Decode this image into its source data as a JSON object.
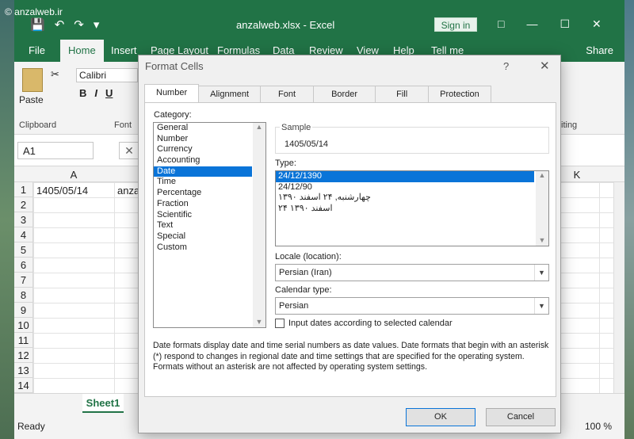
{
  "watermark": "© anzalweb.ir",
  "title": {
    "file": "anzalweb.xlsx - Excel",
    "signin": "Sign in",
    "share": "Share"
  },
  "tabs": [
    {
      "label": "File"
    },
    {
      "label": "Home"
    },
    {
      "label": "Insert"
    },
    {
      "label": "Page Layout"
    },
    {
      "label": "Formulas"
    },
    {
      "label": "Data"
    },
    {
      "label": "Review"
    },
    {
      "label": "View"
    },
    {
      "label": "Help"
    },
    {
      "label": "Tell me"
    }
  ],
  "ribbon": {
    "paste": "Paste",
    "font_name": "Calibri",
    "clipboard": "Clipboard",
    "font": "Font",
    "editing": "iting"
  },
  "namebox": "A1",
  "sheet": {
    "col_a": "A",
    "col_k": "K",
    "rows": [
      "1",
      "2",
      "3",
      "4",
      "5",
      "6",
      "7",
      "8",
      "9",
      "10",
      "11",
      "12",
      "13",
      "14"
    ],
    "a1": "1405/05/14",
    "b1": "anza",
    "tab": "Sheet1"
  },
  "status": {
    "ready": "Ready",
    "zoom": "100 %"
  },
  "dialog": {
    "title": "Format Cells",
    "help": "?",
    "tabs": [
      {
        "label": "Number"
      },
      {
        "label": "Alignment"
      },
      {
        "label": "Font"
      },
      {
        "label": "Border"
      },
      {
        "label": "Fill"
      },
      {
        "label": "Protection"
      }
    ],
    "category_label": "Category:",
    "categories": [
      "General",
      "Number",
      "Currency",
      "Accounting",
      "Date",
      "Time",
      "Percentage",
      "Fraction",
      "Scientific",
      "Text",
      "Special",
      "Custom"
    ],
    "selected_category": "Date",
    "sample_label": "Sample",
    "sample_value": "1405/05/14",
    "type_label": "Type:",
    "types": [
      "24/12/1390",
      "24/12/90",
      "چهارشنبه, ۲۴ اسفند ۱۳۹۰",
      "۲۴ اسفند ۱۳۹۰"
    ],
    "locale_label": "Locale (location):",
    "locale_value": "Persian (Iran)",
    "calendar_label": "Calendar type:",
    "calendar_value": "Persian",
    "checkbox_label": "Input dates according to selected calendar",
    "description": "Date formats display date and time serial numbers as date values.  Date formats that begin with an asterisk (*) respond to changes in regional date and time settings that are specified for the operating system.  Formats without an asterisk are not affected by operating system settings.",
    "ok": "OK",
    "cancel": "Cancel"
  }
}
